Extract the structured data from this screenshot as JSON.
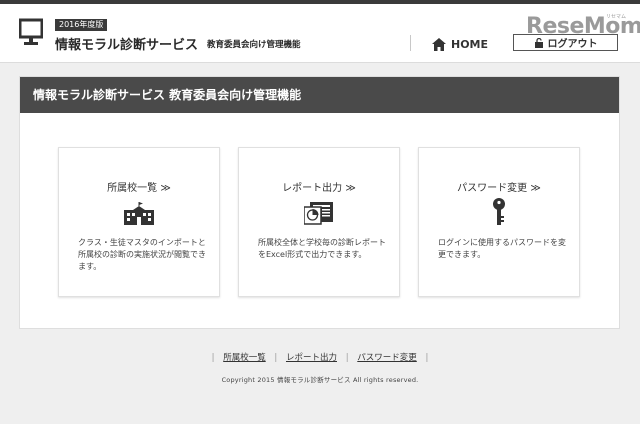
{
  "header": {
    "year_badge": "2016年度版",
    "service_title": "情報モラル診断サービス",
    "service_subtitle": "教育委員会向け管理機能",
    "home_label": "HOME",
    "logout_label": "ログアウト",
    "logo_text": "ReseMom",
    "logo_kana": "リセマム"
  },
  "panel": {
    "title": "情報モラル診断サービス 教育委員会向け管理機能",
    "cards": [
      {
        "title": "所属校一覧 ≫",
        "icon": "school-building-icon",
        "description": "クラス・生徒マスタのインポートと所属校の診断の実施状況が閲覧できます。"
      },
      {
        "title": "レポート出力 ≫",
        "icon": "report-document-icon",
        "description": "所属校全体と学校毎の診断レポートをExcel形式で出力できます。"
      },
      {
        "title": "パスワード変更 ≫",
        "icon": "key-icon",
        "description": "ログインに使用するパスワードを変更できます。"
      }
    ]
  },
  "footer": {
    "links": [
      "所属校一覧",
      "レポート出力",
      "パスワード変更"
    ],
    "copyright": "Copyright 2015 情報モラル診断サービス All rights reserved."
  }
}
